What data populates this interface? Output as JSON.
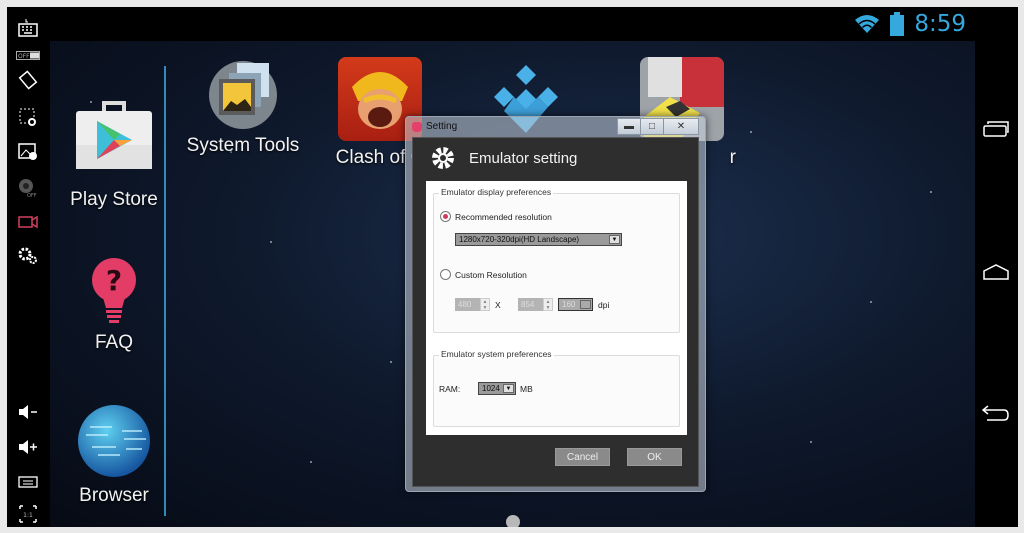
{
  "status_bar": {
    "time": "8:59",
    "icons": [
      "wifi-icon",
      "battery-icon"
    ],
    "accent_color": "#35a8de"
  },
  "left_toolbar": {
    "items": [
      {
        "name": "keyboard-icon"
      },
      {
        "name": "toggle-off-icon",
        "label": "OFF"
      },
      {
        "name": "rotate-icon"
      },
      {
        "name": "screenshot-icon"
      },
      {
        "name": "gallery-icon"
      },
      {
        "name": "camera-off-icon",
        "label": "OFF"
      },
      {
        "name": "video-record-icon",
        "color": "#d0405f"
      },
      {
        "name": "settings-icon"
      },
      {
        "name": "volume-down-icon"
      },
      {
        "name": "volume-up-icon"
      },
      {
        "name": "menu-icon"
      },
      {
        "name": "scale-icon",
        "label": "1:1"
      }
    ]
  },
  "right_nav": {
    "items": [
      "recent-apps-icon",
      "home-icon",
      "back-icon"
    ]
  },
  "desktop": {
    "apps": [
      {
        "label": "Play Store"
      },
      {
        "label": "FAQ"
      },
      {
        "label": "Browser"
      },
      {
        "label": "System Tools"
      },
      {
        "label": "Clash of C"
      },
      {
        "label": ""
      },
      {
        "label": "r"
      }
    ]
  },
  "dialog": {
    "window_title": "Setting",
    "header_title": "Emulator setting",
    "display_group": {
      "legend": "Emulator display preferences",
      "recommended_label": "Recommended resolution",
      "recommended_selected": true,
      "resolution_value": "1280x720-320dpi(HD Landscape)",
      "custom_label": "Custom Resolution",
      "custom_selected": false,
      "width_value": "480",
      "times_label": "X",
      "height_value": "854",
      "dpi_value": "160",
      "dpi_label": "dpi"
    },
    "system_group": {
      "legend": "Emulator system preferences",
      "ram_label": "RAM:",
      "ram_value": "1024",
      "ram_unit": "MB"
    },
    "buttons": {
      "cancel": "Cancel",
      "ok": "OK"
    }
  }
}
